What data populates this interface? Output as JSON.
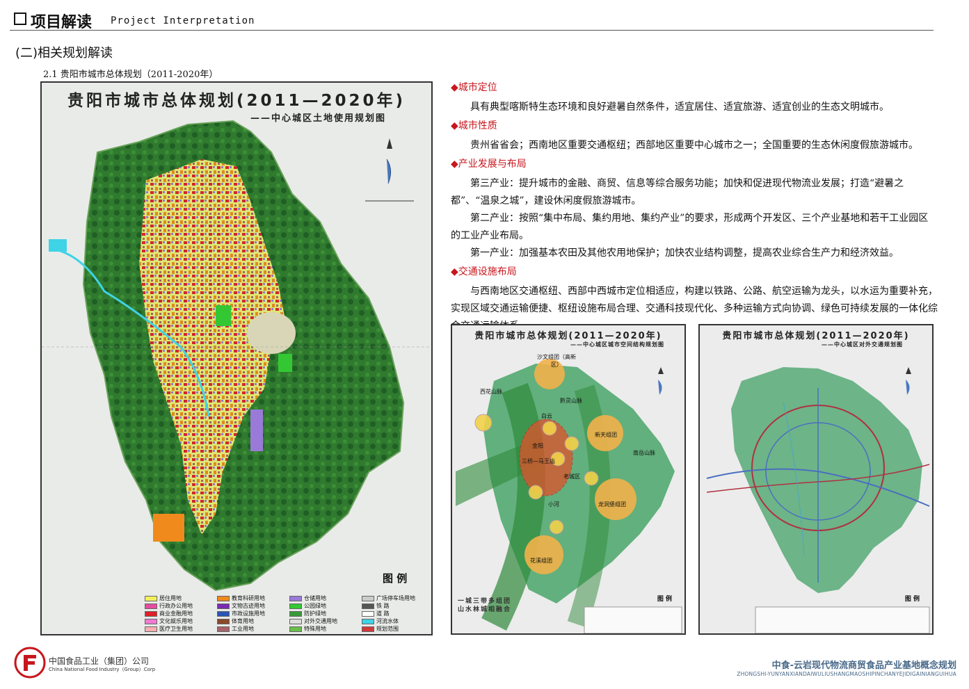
{
  "header": {
    "title": "项目解读",
    "subtitle": "Project Interpretation"
  },
  "section": {
    "title": "(二)相关规划解读",
    "subheading": "2.1 贵阳市城市总体规划（2011-2020年）"
  },
  "main_map": {
    "title": "贵阳市城市总体规划(2011—2020年)",
    "subtitle": "——中心城区土地使用规划图",
    "legend_heading": "图 例",
    "legend": [
      {
        "label": "居住用地",
        "color": "#f3f05c"
      },
      {
        "label": "行政办公用地",
        "color": "#e64ba0"
      },
      {
        "label": "商业金融用地",
        "color": "#e0202a"
      },
      {
        "label": "文化娱乐用地",
        "color": "#f07ad2"
      },
      {
        "label": "医疗卫生用地",
        "color": "#f6b0b0"
      },
      {
        "label": "教育科研用地",
        "color": "#f08a1c"
      },
      {
        "label": "文物古迹用地",
        "color": "#7a2bb0"
      },
      {
        "label": "市政设施用地",
        "color": "#2a55b5"
      },
      {
        "label": "体育用地",
        "color": "#8a4a2a"
      },
      {
        "label": "工业用地",
        "color": "#a8636a"
      },
      {
        "label": "仓储用地",
        "color": "#9a7ad8"
      },
      {
        "label": "公园绿地",
        "color": "#33c833"
      },
      {
        "label": "防护绿地",
        "color": "#3a9a3a"
      },
      {
        "label": "对外交通用地",
        "color": "#dddddd"
      },
      {
        "label": "特殊用地",
        "color": "#6abf4b"
      },
      {
        "label": "广场停车场用地",
        "color": "#cccccc"
      },
      {
        "label": "铁 路",
        "color": "#555555"
      },
      {
        "label": "道 路",
        "color": "#ffffff"
      },
      {
        "label": "河流水体",
        "color": "#3fd3e6"
      },
      {
        "label": "规划范围",
        "color": "#d23a3a"
      }
    ]
  },
  "sections": {
    "positioning": {
      "heading": "◆城市定位",
      "text": "具有典型喀斯特生态环境和良好避暑自然条件，适宜居住、适宜旅游、适宜创业的生态文明城市。"
    },
    "nature": {
      "heading": "◆城市性质",
      "text": "贵州省省会；西南地区重要交通枢纽；西部地区重要中心城市之一；全国重要的生态休闲度假旅游城市。"
    },
    "industry": {
      "heading": "◆产业发展与布局",
      "p1": "第三产业：提升城市的金融、商贸、信息等综合服务功能；加快和促进现代物流业发展；打造“避暑之都”、“温泉之城”，建设休闲度假旅游城市。",
      "p2": "第二产业：按照“集中布局、集约用地、集约产业”的要求，形成两个开发区、三个产业基地和若干工业园区的工业产业布局。",
      "p3": "第一产业：加强基本农田及其他农用地保护；加快农业结构调整，提高农业综合生产力和经济效益。"
    },
    "transport": {
      "heading": "◆交通设施布局",
      "text": "与西南地区交通枢纽、西部中西城市定位相适应，构建以铁路、公路、航空运输为龙头，以水运为重要补充，实现区域交通运输便捷、枢纽设施布局合理、交通科技现代化、多种运输方式向协调、绿色可持续发展的一体化综合交通运输体系。"
    }
  },
  "map_a": {
    "title": "贵阳市城市总体规划(2011—2020年)",
    "subtitle": "——中心城区城市空间结构规划图",
    "legend_heading": "图 例",
    "slogan": "一城三带多组团 山水林城相融合",
    "labels": {
      "shawen": "沙文组团（高新区）",
      "xihua": "西花山脉",
      "qianling": "黔灵山脉",
      "baiyun": "白云",
      "xintian": "新天组团",
      "nanyue": "南岳山脉",
      "jinyang": "金阳",
      "sanqiao": "三桥—马王庙",
      "laocheng": "老城区",
      "longdongbao": "龙洞堡组团",
      "xiaohe": "小河",
      "huaxi": "花溪组团"
    }
  },
  "map_b": {
    "title": "贵阳市城市总体规划(2011—2020年)",
    "subtitle": "——中心城区对外交通规划图",
    "legend_heading": "图 例"
  },
  "footer": {
    "company_cn": "中国食品工业（集团）公司",
    "company_en": "China National Food Industry（Group）Corp",
    "project_cn": "中食-云岩现代物流商贸食品产业基地概念规划",
    "project_en": "ZHONGSHI-YUNYANXIANDAIWULIUSHANGMAOSHIPINCHANYEJIDIGAINIANGUIHUA"
  }
}
